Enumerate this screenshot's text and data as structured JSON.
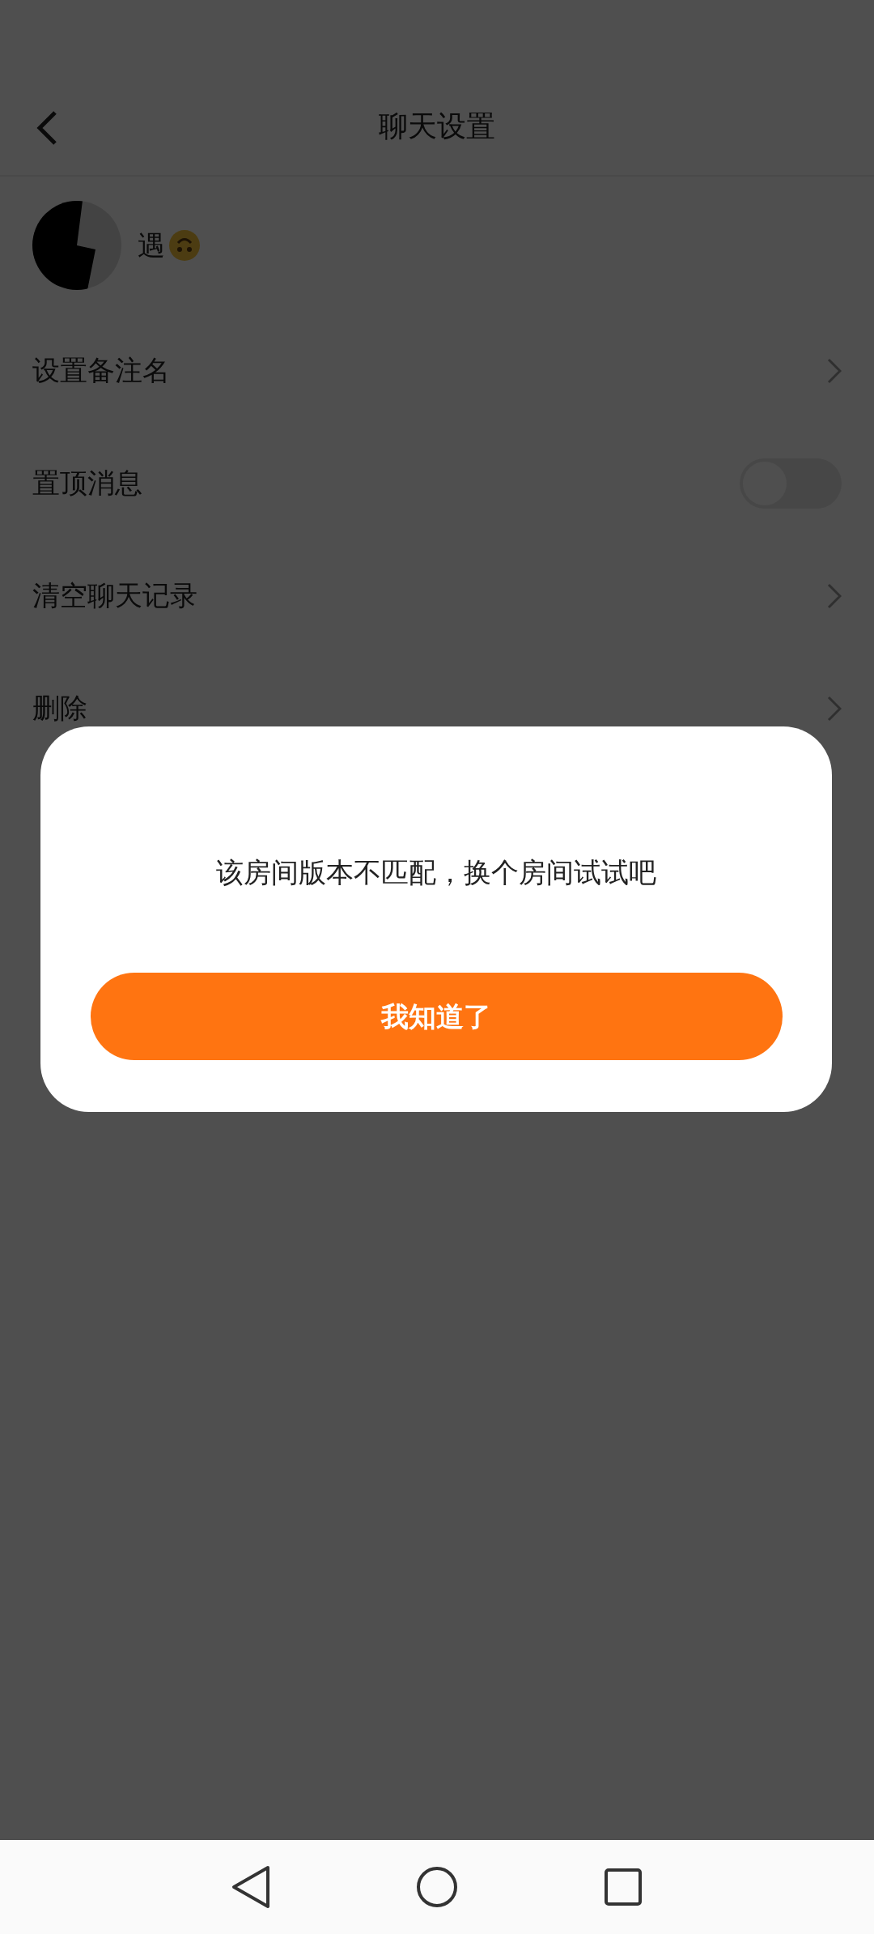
{
  "header": {
    "title": "聊天设置"
  },
  "profile": {
    "name": "遇"
  },
  "settings": [
    {
      "kind": "link",
      "label": "设置备注名"
    },
    {
      "kind": "toggle",
      "label": "置顶消息",
      "on": false
    },
    {
      "kind": "link",
      "label": "清空聊天记录"
    },
    {
      "kind": "link",
      "label": "删除"
    }
  ],
  "dialog": {
    "message": "该房间版本不匹配，换个房间试试吧",
    "button": "我知道了"
  }
}
